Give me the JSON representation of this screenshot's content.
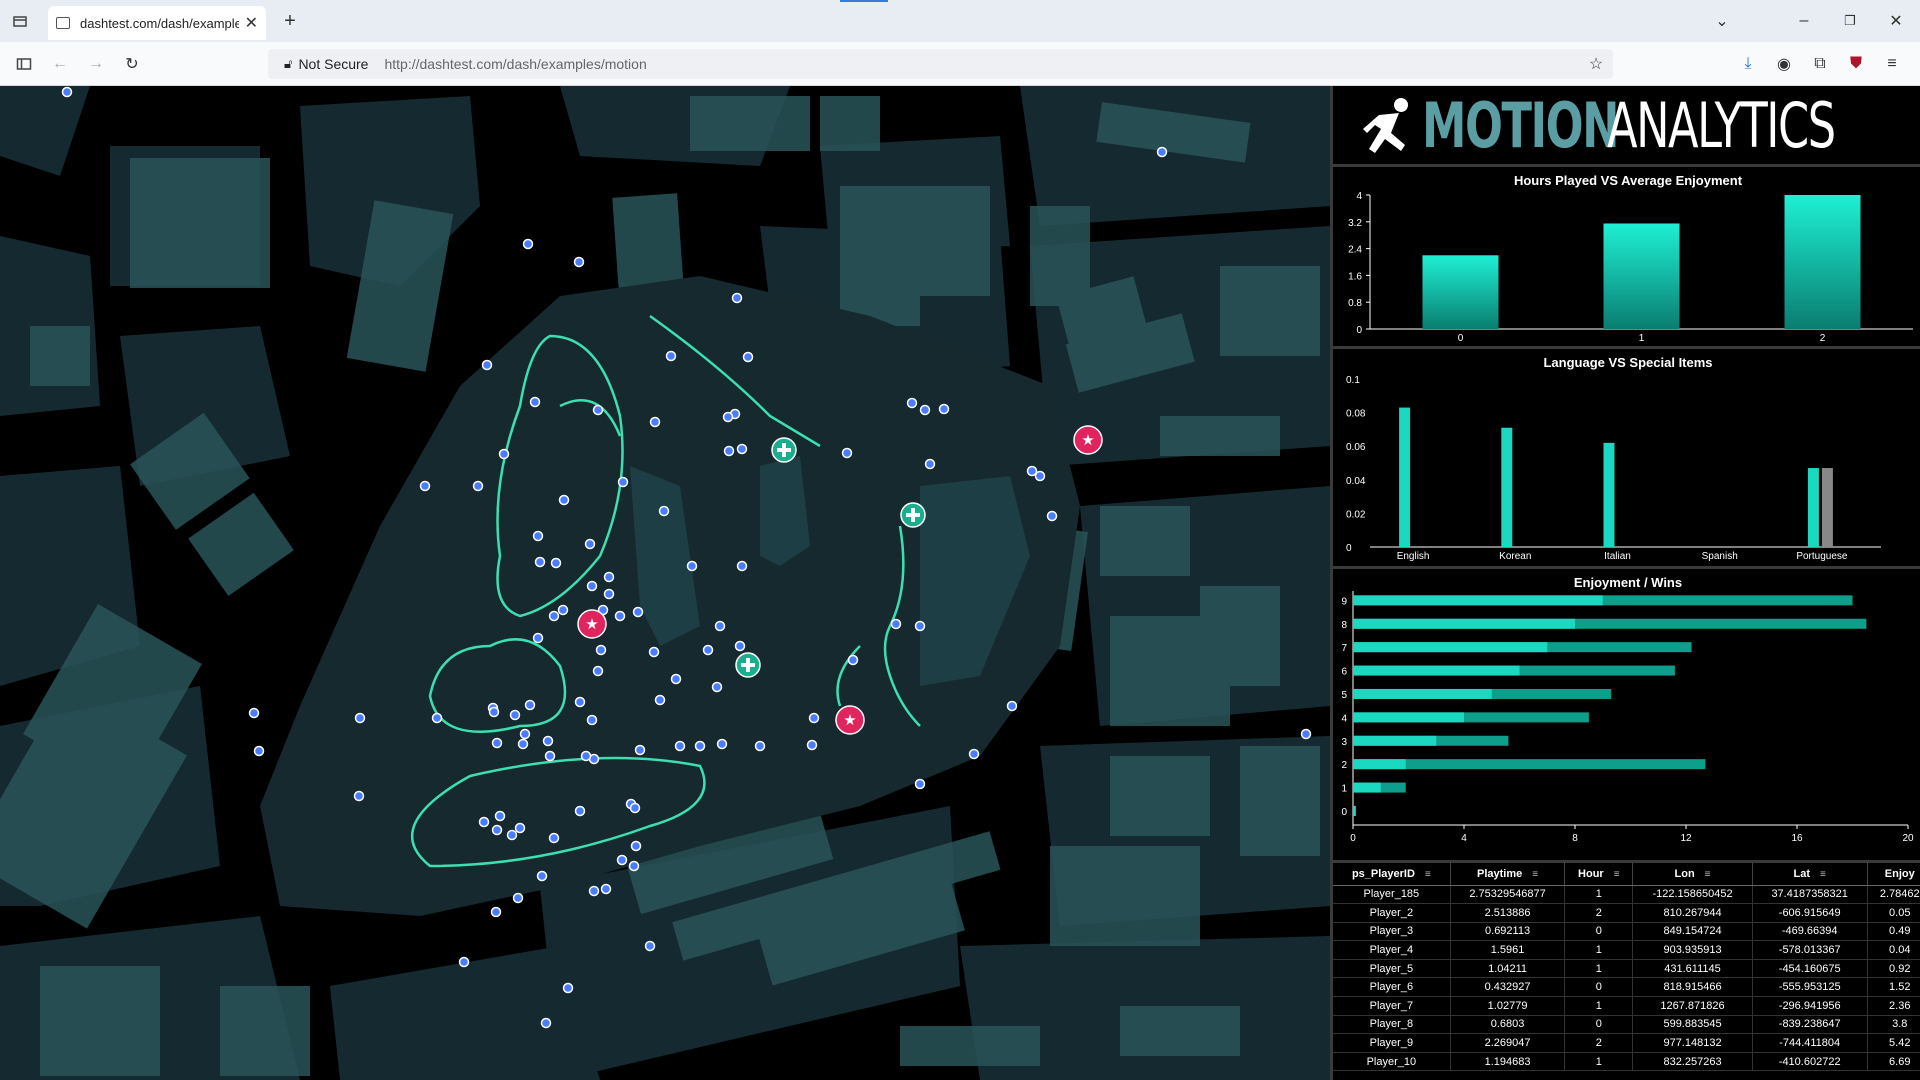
{
  "browser": {
    "tab_title": "dashtest.com/dash/examples/motion",
    "security_label": "Not Secure",
    "url": "http://dashtest.com/dash/examples/motion"
  },
  "brand": {
    "word1": "MOTION",
    "word2": "ANALYTICS",
    "accent_color": "#5a9ea3"
  },
  "chart_data": [
    {
      "type": "bar",
      "title": "Hours Played VS Average Enjoyment",
      "categories": [
        "0",
        "1",
        "2"
      ],
      "values": [
        2.2,
        3.15,
        4.0
      ],
      "ylim": [
        0,
        4
      ],
      "yticks": [
        "0",
        "0.8",
        "1.6",
        "2.4",
        "3.2",
        "4"
      ],
      "color": "#1ad9c0"
    },
    {
      "type": "bar",
      "title": "Language VS Special Items",
      "categories": [
        "English",
        "Korean",
        "Italian",
        "Spanish",
        "Portuguese"
      ],
      "series": [
        {
          "values": [
            0.083,
            0.071,
            0.062,
            0,
            0.047
          ],
          "color": "#1ad9c0"
        },
        {
          "values": [
            0,
            0,
            0,
            0,
            0.047
          ],
          "color": "#888888"
        }
      ],
      "ylim": [
        0,
        0.1
      ],
      "yticks": [
        "0",
        "0.02",
        "0.04",
        "0.06",
        "0.08",
        "0.1"
      ]
    },
    {
      "type": "bar",
      "orientation": "horizontal",
      "title": "Enjoyment / Wins",
      "categories": [
        "0",
        "1",
        "2",
        "3",
        "4",
        "5",
        "6",
        "7",
        "8",
        "9"
      ],
      "series": [
        {
          "values": [
            0.1,
            1.0,
            1.9,
            3.0,
            4.0,
            5.0,
            6.0,
            7.0,
            8.0,
            9.0
          ],
          "color": "#1ad9c0"
        },
        {
          "values": [
            0.1,
            1.9,
            12.7,
            5.6,
            8.5,
            9.3,
            11.6,
            12.2,
            18.5,
            18.0
          ],
          "color": "#0e9f8c"
        }
      ],
      "xlim": [
        0,
        20
      ],
      "xticks": [
        "0",
        "4",
        "8",
        "12",
        "16",
        "20"
      ]
    }
  ],
  "table": {
    "columns": [
      "ps_PlayerID",
      "Playtime",
      "Hour",
      "Lon",
      "Lat",
      "Enjoy"
    ],
    "rows": [
      [
        "Player_185",
        "2.75329546877",
        "1",
        "-122.158650452",
        "37.4187358321",
        "2.78462"
      ],
      [
        "Player_2",
        "2.513886",
        "2",
        "810.267944",
        "-606.915649",
        "0.05"
      ],
      [
        "Player_3",
        "0.692113",
        "0",
        "849.154724",
        "-469.66394",
        "0.49"
      ],
      [
        "Player_4",
        "1.5961",
        "1",
        "903.935913",
        "-578.013367",
        "0.04"
      ],
      [
        "Player_5",
        "1.04211",
        "1",
        "431.611145",
        "-454.160675",
        "0.92"
      ],
      [
        "Player_6",
        "0.432927",
        "0",
        "818.915466",
        "-555.953125",
        "1.52"
      ],
      [
        "Player_7",
        "1.02779",
        "1",
        "1267.871826",
        "-296.941956",
        "2.36"
      ],
      [
        "Player_8",
        "0.6803",
        "0",
        "599.883545",
        "-839.238647",
        "3.8"
      ],
      [
        "Player_9",
        "2.269047",
        "2",
        "977.148132",
        "-744.411804",
        "5.42"
      ],
      [
        "Player_10",
        "1.194683",
        "1",
        "832.257263",
        "-410.602722",
        "6.69"
      ]
    ]
  },
  "map": {
    "background": "#12262a",
    "park_color": "#17323a",
    "path_color": "#3ddfb0",
    "player_color": "#4a7cff",
    "event_color": "#e0245e",
    "medic_color": "#1bae8e"
  }
}
